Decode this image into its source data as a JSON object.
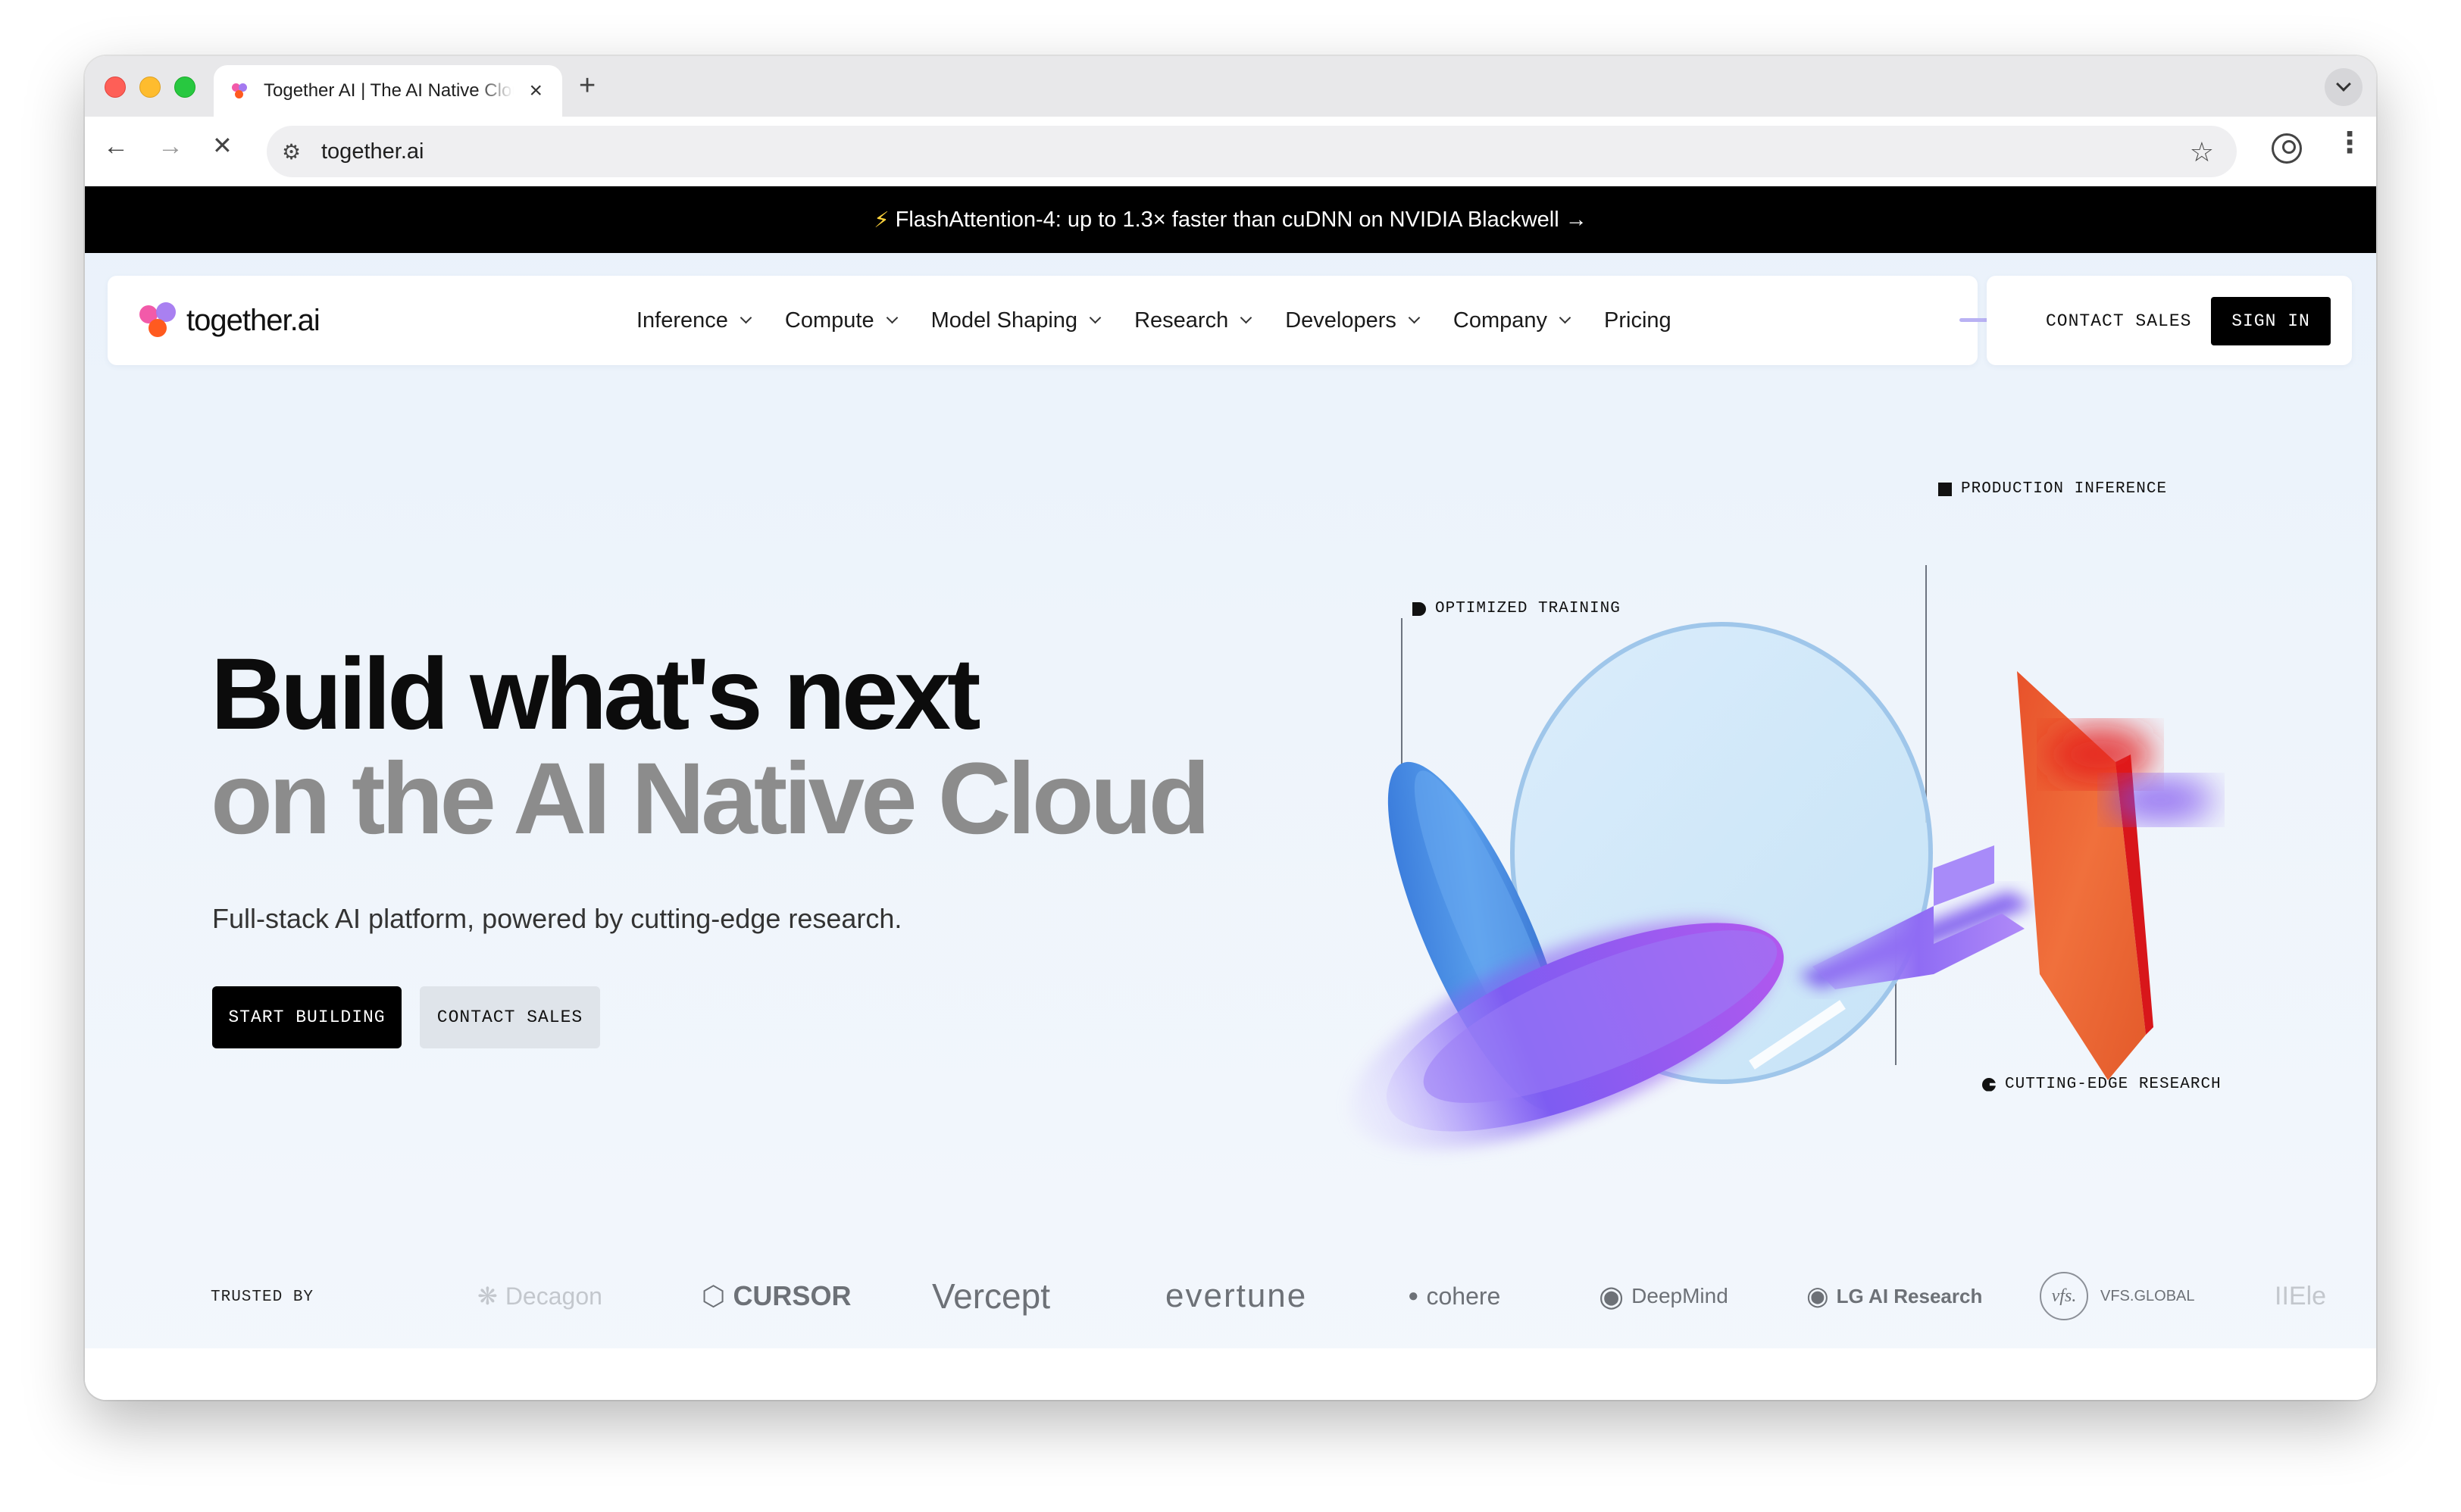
{
  "browser": {
    "tab_title": "Together AI | The AI Native Cloud",
    "new_tab": "+",
    "close_tab": "×",
    "url": "together.ai"
  },
  "banner": {
    "text": "FlashAttention-4: up to 1.3× faster than cuDNN on NVIDIA Blackwell →"
  },
  "nav": {
    "logo_text": "together.ai",
    "items": [
      {
        "label": "Inference"
      },
      {
        "label": "Compute"
      },
      {
        "label": "Model Shaping"
      },
      {
        "label": "Research"
      },
      {
        "label": "Developers"
      },
      {
        "label": "Company"
      },
      {
        "label": "Pricing"
      }
    ],
    "contact_sales": "CONTACT SALES",
    "sign_in": "SIGN IN"
  },
  "hero": {
    "title_line1": "Build what's next",
    "title_line2": "on the AI Native Cloud",
    "subtitle": "Full-stack AI platform, powered by cutting-edge research.",
    "cta_primary": "START BUILDING",
    "cta_secondary": "CONTACT SALES"
  },
  "illustration": {
    "label_training": "OPTIMIZED TRAINING",
    "label_inference": "PRODUCTION INFERENCE",
    "label_research": "CUTTING-EDGE RESEARCH"
  },
  "trusted": {
    "label": "TRUSTED BY",
    "logos": [
      {
        "name": "Decagon"
      },
      {
        "name": "CURSOR"
      },
      {
        "name": "Vercept"
      },
      {
        "name": "evertune"
      },
      {
        "name": "cohere"
      },
      {
        "name": "DeepMind"
      },
      {
        "name": "LG AI Research"
      },
      {
        "name": "VFS.GLOBAL",
        "badge": "vfs."
      },
      {
        "name": "IIEle"
      }
    ]
  },
  "colors": {
    "accent_blue": "#3f7fd9",
    "accent_purple": "#8b5cf6",
    "accent_orange": "#f0683a",
    "accent_red": "#e3201f",
    "logo_pink": "#f25aa9",
    "logo_purple": "#a479f0",
    "logo_orange": "#ff5a1f"
  }
}
